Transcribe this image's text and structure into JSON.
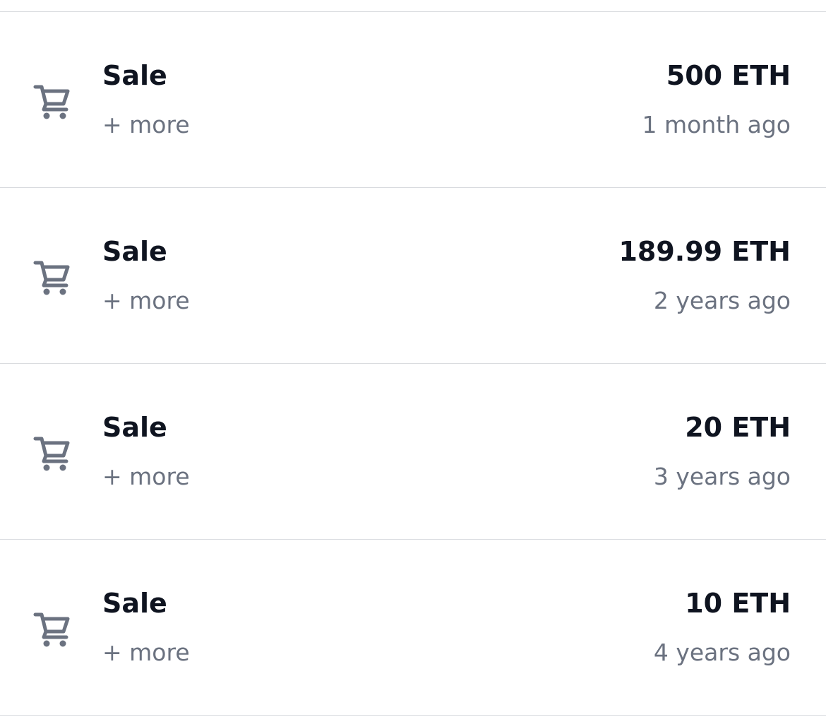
{
  "activity": {
    "rows": [
      {
        "icon": "cart-icon",
        "event": "Sale",
        "more_label": "+ more",
        "price": "500 ETH",
        "time": "1 month ago"
      },
      {
        "icon": "cart-icon",
        "event": "Sale",
        "more_label": "+ more",
        "price": "189.99 ETH",
        "time": "2 years ago"
      },
      {
        "icon": "cart-icon",
        "event": "Sale",
        "more_label": "+ more",
        "price": "20 ETH",
        "time": "3 years ago"
      },
      {
        "icon": "cart-icon",
        "event": "Sale",
        "more_label": "+ more",
        "price": "10 ETH",
        "time": "4 years ago"
      }
    ]
  },
  "colors": {
    "text_primary": "#0f1420",
    "text_secondary": "#6b7280",
    "icon": "#6b7280",
    "divider": "#d9dbdf"
  }
}
